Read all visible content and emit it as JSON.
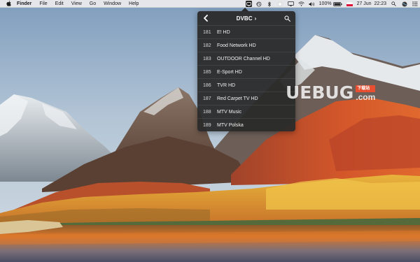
{
  "menubar": {
    "app_name": "Finder",
    "menus": [
      "File",
      "Edit",
      "View",
      "Go",
      "Window",
      "Help"
    ],
    "status_icons": [
      "tv-tuner-icon",
      "time-machine-icon",
      "bluetooth-icon",
      "circle-icon",
      "display-icon",
      "wifi-icon",
      "volume-icon"
    ],
    "battery": "100%",
    "flag_icon": "poland-flag-icon",
    "date_time": "27 Jun  22:23",
    "right_icons": [
      "spotlight-icon",
      "siri-icon",
      "notification-center-icon"
    ]
  },
  "popover": {
    "title": "DVBC",
    "title_caret": "›",
    "channels": [
      {
        "number": "181",
        "name": "E! HD"
      },
      {
        "number": "182",
        "name": "Food Network HD"
      },
      {
        "number": "183",
        "name": "OUTDOOR Channel HD"
      },
      {
        "number": "185",
        "name": "E-Sport HD"
      },
      {
        "number": "186",
        "name": "TVR HD"
      },
      {
        "number": "187",
        "name": "Red Carpet TV HD"
      },
      {
        "number": "188",
        "name": "MTV Music"
      },
      {
        "number": "189",
        "name": "MTV Polska"
      }
    ]
  },
  "watermark": {
    "text": "UEBUG",
    "badge": "下载站",
    "suffix": ".com"
  },
  "colors": {
    "popover_bg": "#2a2a2a",
    "menubar_bg": "#ececec",
    "watermark_badge": "#e84f30"
  }
}
